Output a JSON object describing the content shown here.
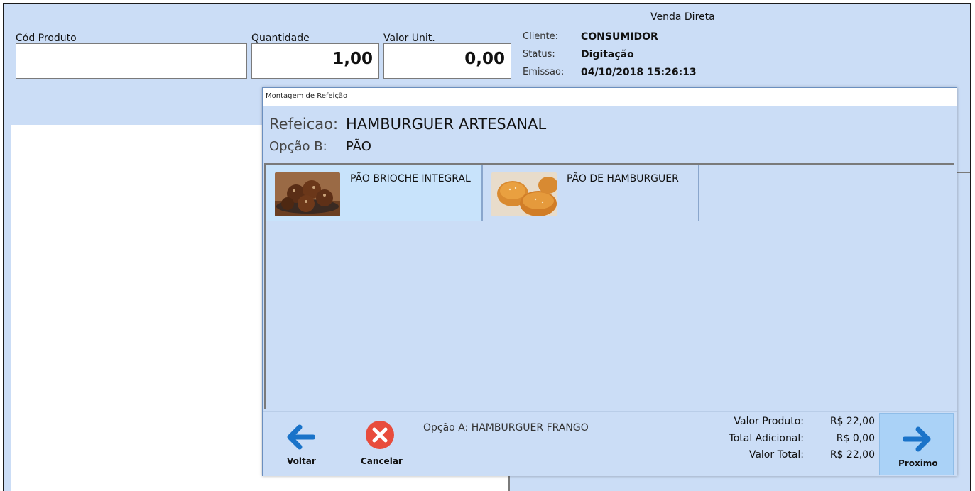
{
  "window": {
    "title": "Venda Direta",
    "fields": {
      "cod_produto_label": "Cód Produto",
      "cod_produto_value": "",
      "quantidade_label": "Quantidade",
      "quantidade_value": "1,00",
      "valor_unit_label": "Valor Unit.",
      "valor_unit_value": "0,00"
    },
    "info": {
      "cliente_label": "Cliente:",
      "cliente_value": "CONSUMIDOR",
      "status_label": "Status:",
      "status_value": "Digitação",
      "emissao_label": "Emissao:",
      "emissao_value": "04/10/2018 15:26:13"
    }
  },
  "dialog": {
    "title": "Montagem de Refeição",
    "refeicao_label": "Refeicao:",
    "refeicao_value": "HAMBURGUER ARTESANAL",
    "opcao_label": "Opção B:",
    "opcao_value": "PÃO",
    "options": [
      {
        "label": "PÃO BRIOCHE INTEGRAL",
        "selected": true
      },
      {
        "label": "PÃO DE HAMBURGUER",
        "selected": false
      }
    ],
    "footer": {
      "voltar_label": "Voltar",
      "cancelar_label": "Cancelar",
      "note": "Opção A: HAMBURGUER FRANGO",
      "valor_produto_label": "Valor Produto:",
      "valor_produto_value": "R$ 22,00",
      "total_adicional_label": "Total Adicional:",
      "total_adicional_value": "R$ 0,00",
      "valor_total_label": "Valor Total:",
      "valor_total_value": "R$ 22,00",
      "proximo_label": "Proximo"
    }
  },
  "icons": {
    "voltar": "arrow-left-icon",
    "cancelar": "cancel-x-icon",
    "proximo": "arrow-right-icon"
  },
  "colors": {
    "panel_bg": "#cbddf6",
    "arrow_blue": "#1a73c9",
    "cancel_red": "#e84c3d",
    "selected_tile": "#c8e3fb"
  }
}
